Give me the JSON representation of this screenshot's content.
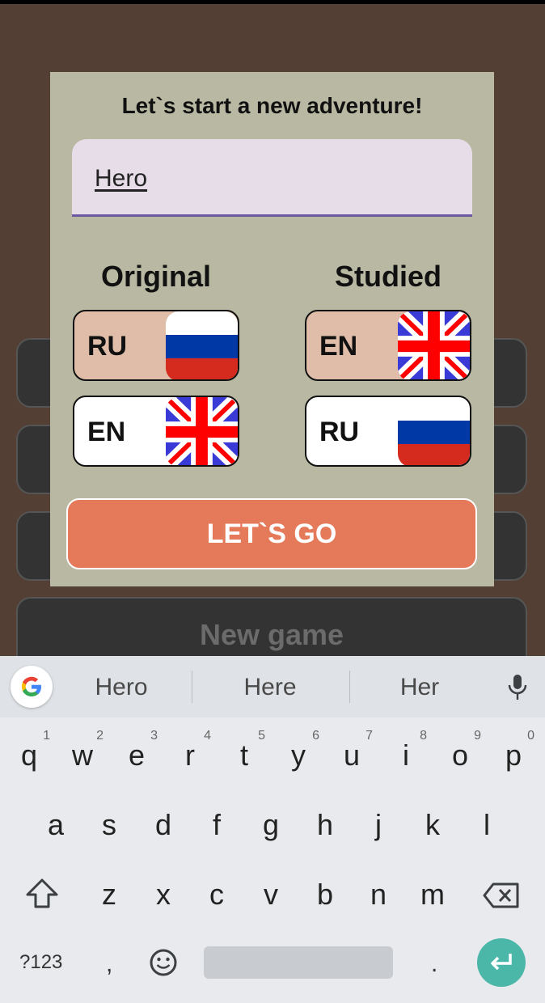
{
  "background_menu": {
    "new_game_label": "New game"
  },
  "dialog": {
    "title": "Let`s start a new adventure!",
    "name_input_value": "Hero",
    "original_title": "Original",
    "studied_title": "Studied",
    "original_options": [
      {
        "code": "RU",
        "flag": "russia-flag",
        "selected": true
      },
      {
        "code": "EN",
        "flag": "uk-flag",
        "selected": false
      }
    ],
    "studied_options": [
      {
        "code": "EN",
        "flag": "uk-flag",
        "selected": true
      },
      {
        "code": "RU",
        "flag": "russia-flag",
        "selected": false
      }
    ],
    "go_button_label": "LET`S GO"
  },
  "keyboard": {
    "suggestions": [
      "Hero",
      "Here",
      "Her"
    ],
    "row1": [
      {
        "key": "q",
        "hint": "1"
      },
      {
        "key": "w",
        "hint": "2"
      },
      {
        "key": "e",
        "hint": "3"
      },
      {
        "key": "r",
        "hint": "4"
      },
      {
        "key": "t",
        "hint": "5"
      },
      {
        "key": "y",
        "hint": "6"
      },
      {
        "key": "u",
        "hint": "7"
      },
      {
        "key": "i",
        "hint": "8"
      },
      {
        "key": "o",
        "hint": "9"
      },
      {
        "key": "p",
        "hint": "0"
      }
    ],
    "row2": [
      "a",
      "s",
      "d",
      "f",
      "g",
      "h",
      "j",
      "k",
      "l"
    ],
    "row3": [
      "z",
      "x",
      "c",
      "v",
      "b",
      "n",
      "m"
    ],
    "symbols_label": "?123",
    "comma_label": ",",
    "period_label": "."
  },
  "colors": {
    "background": "#543f35",
    "dialog": "#b8b8a3",
    "selected_option": "#dfbda9",
    "go_button": "#e57a5b",
    "enter_key": "#4ab7a8",
    "input_underline": "#6a59a0"
  }
}
